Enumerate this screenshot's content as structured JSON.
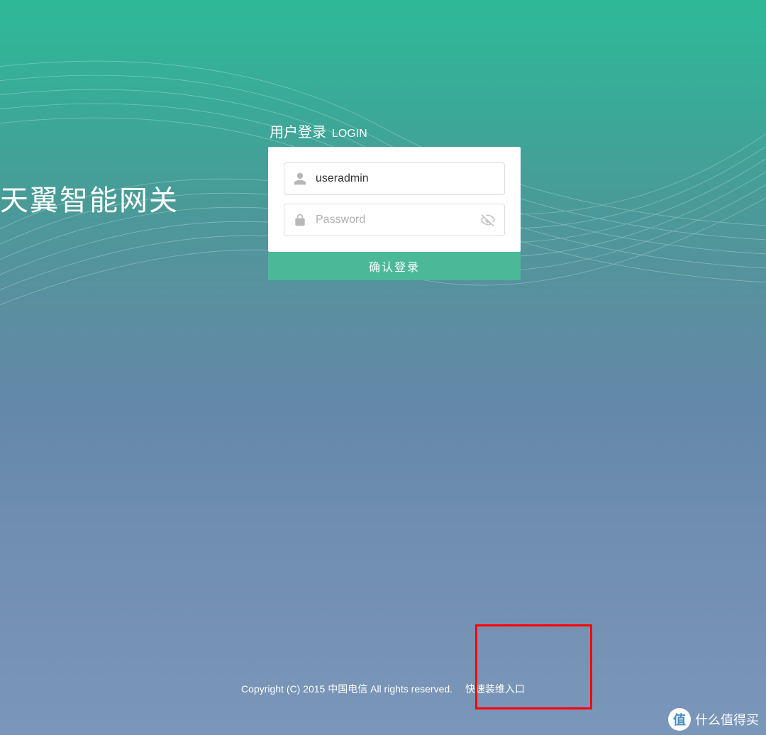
{
  "brand": {
    "title": "天翼智能网关"
  },
  "login": {
    "header_main": "用户登录",
    "header_sub": "LOGIN",
    "username_value": "useradmin",
    "password_placeholder": "Password",
    "password_value": "",
    "submit_label": "确认登录"
  },
  "footer": {
    "copyright": "Copyright (C) 2015 中国电信 All rights reserved.",
    "quick_link_label": "快速装维入口"
  },
  "watermark": {
    "icon_text": "值",
    "label": "什么值得买"
  }
}
